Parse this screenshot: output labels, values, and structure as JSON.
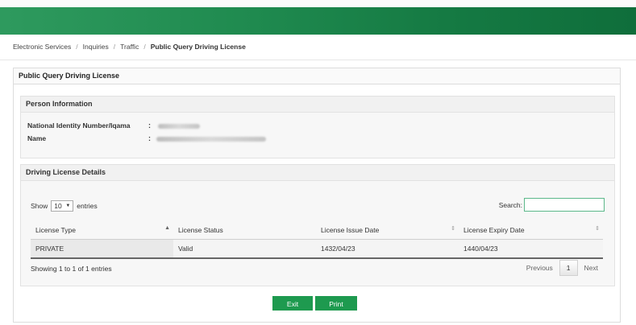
{
  "breadcrumb": {
    "items": [
      "Electronic Services",
      "Inquiries",
      "Traffic"
    ],
    "current": "Public Query Driving License",
    "separator": "/"
  },
  "page": {
    "title": "Public Query Driving License"
  },
  "person": {
    "title": "Person Information",
    "id_label": "National Identity Number/Iqama",
    "name_label": "Name",
    "colon": ":"
  },
  "license": {
    "title": "Driving License Details",
    "show_label": "Show",
    "entries_label": "entries",
    "page_size": "10",
    "search_label": "Search:",
    "columns": [
      "License Type",
      "License Status",
      "License Issue Date",
      "License Expiry Date"
    ],
    "rows": [
      [
        "PRIVATE",
        "Valid",
        "1432/04/23",
        "1440/04/23"
      ]
    ],
    "info": "Showing 1 to 1 of 1 entries",
    "pager": {
      "previous": "Previous",
      "current": "1",
      "next": "Next"
    }
  },
  "actions": {
    "exit": "Exit",
    "print": "Print"
  },
  "colors": {
    "accent": "#1e9a4f",
    "header_bar": "#1f8a4f"
  }
}
